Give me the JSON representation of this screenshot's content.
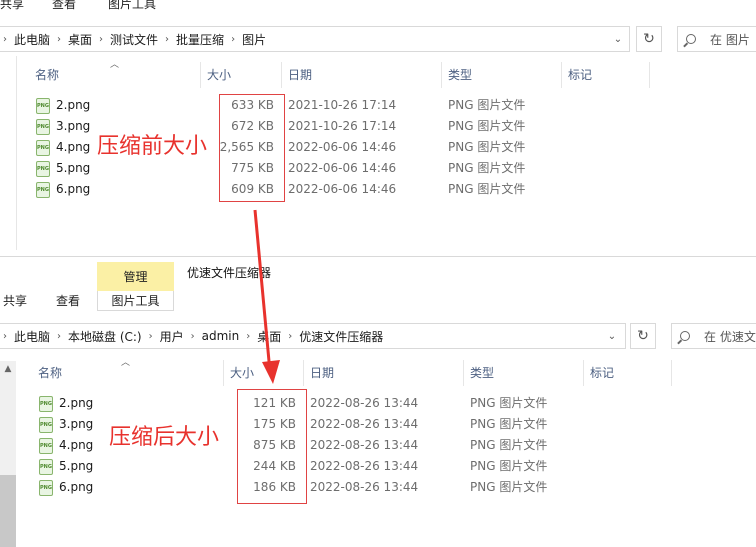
{
  "window_before": {
    "ribbon_tabs": [
      "共享",
      "查看",
      "图片工具"
    ],
    "breadcrumb": [
      "此电脑",
      "桌面",
      "测试文件",
      "批量压缩",
      "图片"
    ],
    "search_placeholder": "在 图片",
    "columns": [
      "名称",
      "大小",
      "日期",
      "类型",
      "标记"
    ],
    "files": [
      {
        "name": "2.png",
        "size": "633 KB",
        "date": "2021-10-26 17:14",
        "type": "PNG 图片文件"
      },
      {
        "name": "3.png",
        "size": "672 KB",
        "date": "2021-10-26 17:14",
        "type": "PNG 图片文件"
      },
      {
        "name": "4.png",
        "size": "2,565 KB",
        "date": "2022-06-06 14:46",
        "type": "PNG 图片文件"
      },
      {
        "name": "5.png",
        "size": "775 KB",
        "date": "2022-06-06 14:46",
        "type": "PNG 图片文件"
      },
      {
        "name": "6.png",
        "size": "609 KB",
        "date": "2022-06-06 14:46",
        "type": "PNG 图片文件"
      }
    ],
    "annotation": "压缩前大小"
  },
  "window_after": {
    "manage_tab": "管理",
    "title": "优速文件压缩器",
    "ribbon_tabs": [
      "共享",
      "查看",
      "图片工具"
    ],
    "breadcrumb": [
      "此电脑",
      "本地磁盘 (C:)",
      "用户",
      "admin",
      "桌面",
      "优速文件压缩器"
    ],
    "search_placeholder": "在 优速文",
    "columns": [
      "名称",
      "大小",
      "日期",
      "类型",
      "标记"
    ],
    "files": [
      {
        "name": "2.png",
        "size": "121 KB",
        "date": "2022-08-26 13:44",
        "type": "PNG 图片文件"
      },
      {
        "name": "3.png",
        "size": "175 KB",
        "date": "2022-08-26 13:44",
        "type": "PNG 图片文件"
      },
      {
        "name": "4.png",
        "size": "875 KB",
        "date": "2022-08-26 13:44",
        "type": "PNG 图片文件"
      },
      {
        "name": "5.png",
        "size": "244 KB",
        "date": "2022-08-26 13:44",
        "type": "PNG 图片文件"
      },
      {
        "name": "6.png",
        "size": "186 KB",
        "date": "2022-08-26 13:44",
        "type": "PNG 图片文件"
      }
    ],
    "annotation": "压缩后大小"
  },
  "icons": {
    "file_icon_text": "PNG",
    "dropdown": "chevron-down-icon",
    "refresh": "refresh-icon",
    "search": "search-icon"
  },
  "colors": {
    "annotation_red": "#e8322d",
    "manage_tab_bg": "#fbf0a5",
    "column_header_text": "#4d6082"
  }
}
